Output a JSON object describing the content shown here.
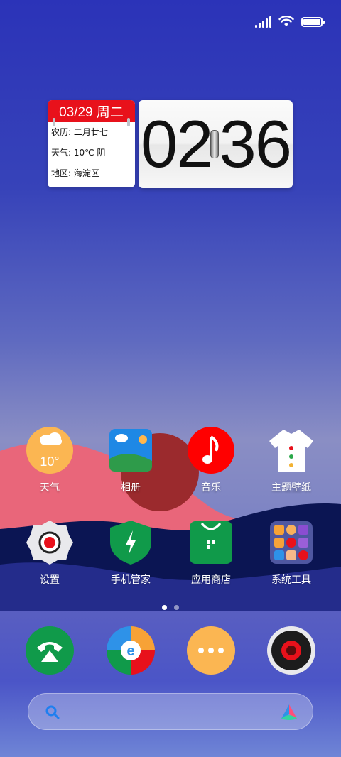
{
  "status_bar": {
    "icons": [
      "signal-icon",
      "wifi-icon",
      "battery-icon"
    ]
  },
  "widgets": {
    "calendar": {
      "date": "03/29 周二",
      "lunar": "农历: 二月廿七",
      "weather": "天气: 10℃ 阴",
      "district": "地区: 海淀区"
    },
    "clock": {
      "time": "02:36",
      "hours": "02",
      "minutes": "36"
    }
  },
  "apps_row1": [
    {
      "label": "天气",
      "icon": "weather-icon",
      "temp": "10°"
    },
    {
      "label": "相册",
      "icon": "gallery-icon"
    },
    {
      "label": "音乐",
      "icon": "music-icon"
    },
    {
      "label": "主题壁纸",
      "icon": "themes-icon"
    }
  ],
  "apps_row2": [
    {
      "label": "设置",
      "icon": "settings-icon"
    },
    {
      "label": "手机管家",
      "icon": "security-icon"
    },
    {
      "label": "应用商店",
      "icon": "app-store-icon"
    },
    {
      "label": "系统工具",
      "icon": "system-tools-folder-icon"
    }
  ],
  "page_indicator": {
    "pages": 2,
    "current": 1
  },
  "dock": [
    {
      "icon": "phone-icon"
    },
    {
      "icon": "browser-icon",
      "glyph": "e"
    },
    {
      "icon": "messages-icon"
    },
    {
      "icon": "camera-icon"
    }
  ],
  "search": {
    "icons": [
      "search-icon",
      "assistant-icon"
    ]
  },
  "colors": {
    "calendar_header": "#e8111b",
    "music": "#ff0000",
    "settings_dot": "#e8111b"
  }
}
